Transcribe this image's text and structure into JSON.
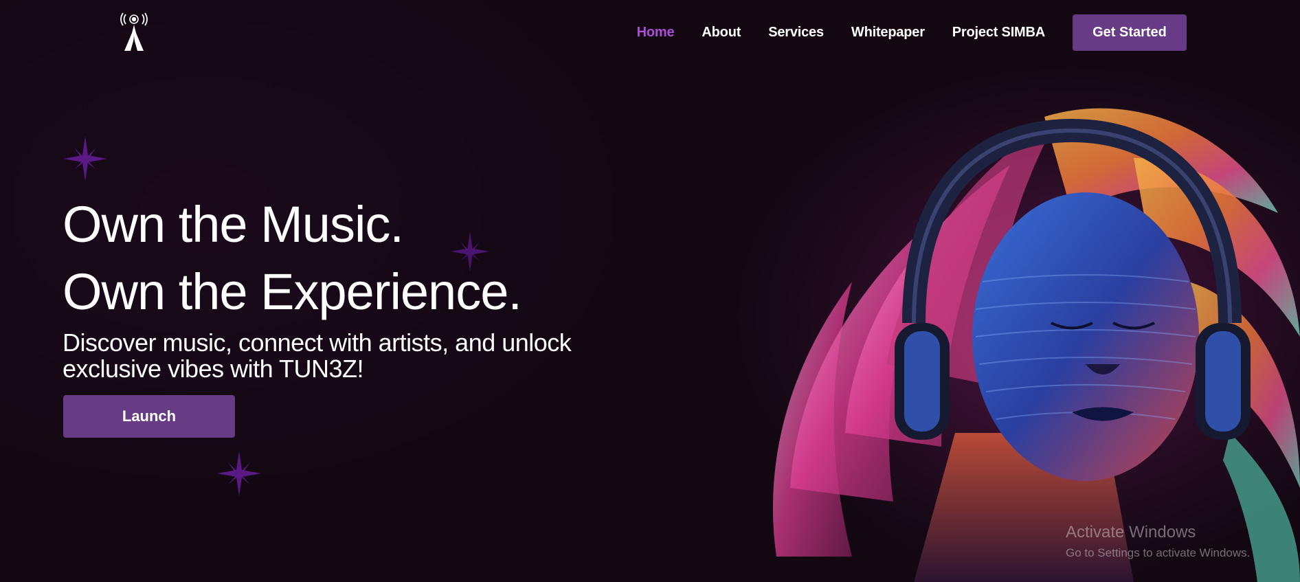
{
  "nav": {
    "items": [
      {
        "label": "Home",
        "active": true
      },
      {
        "label": "About",
        "active": false
      },
      {
        "label": "Services",
        "active": false
      },
      {
        "label": "Whitepaper",
        "active": false
      },
      {
        "label": "Project SIMBA",
        "active": false
      }
    ],
    "cta_label": "Get Started"
  },
  "logo": {
    "icon": "radio-tower-icon"
  },
  "hero": {
    "headline_line1": "Own the Music.",
    "headline_line2": "Own the Experience.",
    "subtext": "Discover music, connect with artists, and unlock exclusive vibes with TUN3Z!",
    "launch_label": "Launch",
    "art": "woman-with-headphones-illustration"
  },
  "watermark": {
    "title": "Activate Windows",
    "subtitle": "Go to Settings to activate Windows."
  },
  "colors": {
    "background": "#130812",
    "accent": "#673b86",
    "active_link": "#a94fd6",
    "star": "#5a1a86"
  }
}
